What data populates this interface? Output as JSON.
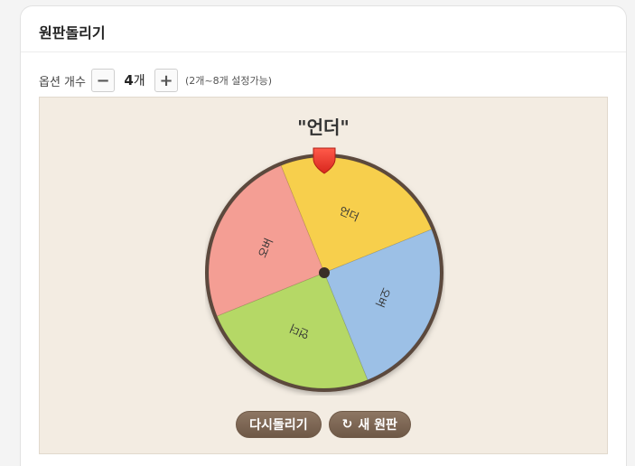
{
  "card": {
    "title": "원판돌리기"
  },
  "controls": {
    "option_label": "옵션 개수",
    "minus": "−",
    "count_value": "4",
    "count_unit": "개",
    "plus": "+",
    "hint": "(2개~8개 설정가능)"
  },
  "wheel": {
    "result": "\"언더\"",
    "segments": [
      {
        "label": "언더",
        "color": "#f7cf4c"
      },
      {
        "label": "오버",
        "color": "#9cc0e6"
      },
      {
        "label": "언더",
        "color": "#b5d866"
      },
      {
        "label": "오버",
        "color": "#f49e94"
      }
    ],
    "rim_color": "#5b4a3e",
    "pointer_color": "#e83a2f"
  },
  "buttons": {
    "respin": "다시돌리기",
    "new_wheel_icon": "refresh-icon",
    "new_wheel": "새 원판"
  }
}
